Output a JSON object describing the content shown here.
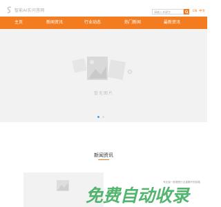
{
  "header": {
    "logo_text": "智能AI实问答网",
    "search_placeholder": "请输入关键字",
    "lang_en": "EN",
    "lang_cn": "中文",
    "search_icon": "search-icon"
  },
  "nav": {
    "items": [
      {
        "label": "主页"
      },
      {
        "label": "新闻资讯"
      },
      {
        "label": "行业动态"
      },
      {
        "label": "热门新闻"
      },
      {
        "label": "最新资讯"
      }
    ]
  },
  "banner": {
    "placeholder_text": "暂无图片",
    "slide_count": 2,
    "active_slide": 1
  },
  "news": {
    "title": "新闻资讯",
    "item_text": "专业独一般遭受行业重要开拓前路"
  },
  "watermark": {
    "text": "免费自动收录"
  },
  "colors": {
    "accent": "#f47c20",
    "banner_bg": "#f2f2f2",
    "active_dot": "#4a9fe0",
    "watermark": "#34a853"
  }
}
